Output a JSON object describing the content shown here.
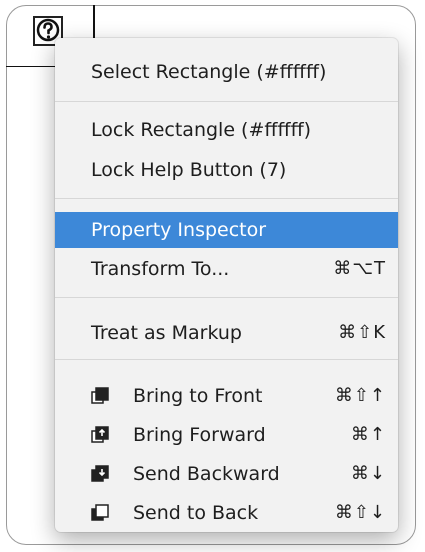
{
  "menu": {
    "select_rectangle": "Select Rectangle (#ffffff)",
    "lock_rectangle": "Lock Rectangle (#ffffff)",
    "lock_help_button": "Lock Help Button (7)",
    "property_inspector": "Property Inspector",
    "transform_to": {
      "label": "Transform To...",
      "shortcut": "⌘⌥T"
    },
    "treat_as_markup": {
      "label": "Treat as Markup",
      "shortcut": "⌘⇧K"
    },
    "bring_to_front": {
      "label": "Bring to Front",
      "shortcut": "⌘⇧↑",
      "icon": "bring-to-front-icon"
    },
    "bring_forward": {
      "label": "Bring Forward",
      "shortcut": "⌘↑",
      "icon": "bring-forward-icon"
    },
    "send_backward": {
      "label": "Send Backward",
      "shortcut": "⌘↓",
      "icon": "send-backward-icon"
    },
    "send_to_back": {
      "label": "Send to Back",
      "shortcut": "⌘⇧↓",
      "icon": "send-to-back-icon"
    }
  },
  "canvas": {
    "help_button_icon": "question-mark-icon"
  },
  "colors": {
    "highlight": "#3d88d8",
    "menu_background": "#f2f2f2",
    "text": "#1e1e1e"
  }
}
